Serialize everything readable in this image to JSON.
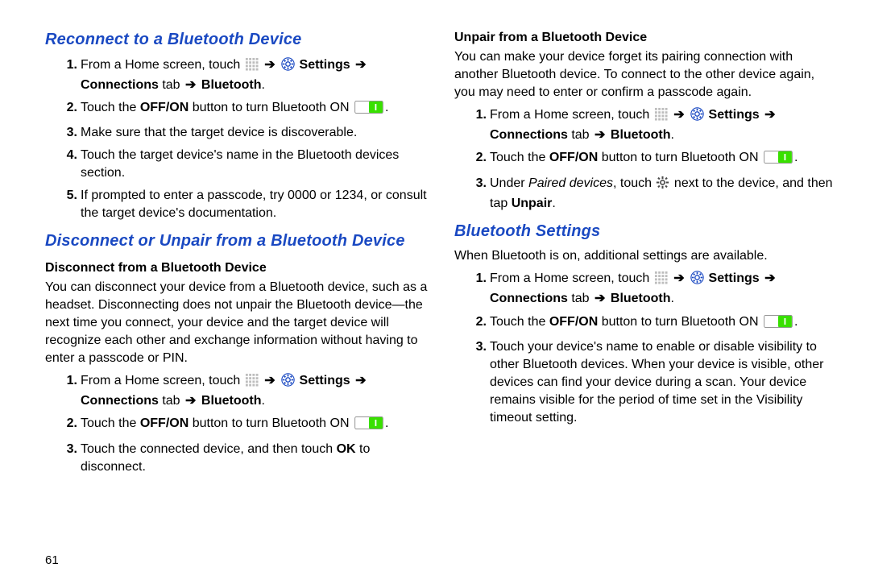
{
  "page_number": "61",
  "arrow": "➔",
  "icons": {
    "apps": "apps-grid-icon",
    "settings": "settings-gear-icon",
    "toggle": "toggle-on-icon",
    "gear": "device-gear-icon"
  },
  "left": {
    "sec1": {
      "title": "Reconnect to a Bluetooth Device",
      "steps": {
        "s1a": "From a Home screen, touch ",
        "s1b": " Settings ",
        "s1c": "Connections",
        "s1d": " tab ",
        "s1e": " Bluetooth",
        "s2a": "Touch the ",
        "s2b": "OFF/ON",
        "s2c": " button to turn Bluetooth ON ",
        "s3": "Make sure that the target device is discoverable.",
        "s4": "Touch the target device's name in the Bluetooth devices section.",
        "s5": "If prompted to enter a passcode, try 0000 or 1234, or consult the target device's documentation."
      }
    },
    "sec2": {
      "title": "Disconnect or Unpair from a Bluetooth Device",
      "sub1": {
        "title": "Disconnect from a Bluetooth Device",
        "intro": "You can disconnect your device from a Bluetooth device, such as a headset. Disconnecting does not unpair the Bluetooth device—the next time you connect, your device and the target device will recognize each other and exchange information without having to enter a passcode or PIN.",
        "steps": {
          "s1a": "From a Home screen, touch ",
          "s1b": " Settings ",
          "s1c": "Connections",
          "s1d": " tab ",
          "s1e": " Bluetooth",
          "s2a": "Touch the ",
          "s2b": "OFF/ON",
          "s2c": " button to turn Bluetooth ON ",
          "s3a": "Touch the connected device, and then touch ",
          "s3b": "OK",
          "s3c": " to disconnect."
        }
      }
    }
  },
  "right": {
    "sub2": {
      "title": "Unpair from a Bluetooth Device",
      "intro": "You can make your device forget its pairing connection with another Bluetooth device. To connect to the other device again, you may need to enter or confirm a passcode again.",
      "steps": {
        "s1a": "From a Home screen, touch ",
        "s1b": " Settings ",
        "s1c": "Connections",
        "s1d": " tab ",
        "s1e": " Bluetooth",
        "s2a": "Touch the ",
        "s2b": "OFF/ON",
        "s2c": " button to turn Bluetooth ON ",
        "s3a": "Under ",
        "s3b": "Paired devices",
        "s3c": ", touch ",
        "s3d": " next to the device, and then tap ",
        "s3e": "Unpair"
      }
    },
    "sec3": {
      "title": "Bluetooth Settings",
      "intro": "When Bluetooth is on, additional settings are available.",
      "steps": {
        "s1a": "From a Home screen, touch ",
        "s1b": " Settings ",
        "s1c": "Connections",
        "s1d": " tab ",
        "s1e": " Bluetooth",
        "s2a": "Touch the ",
        "s2b": "OFF/ON",
        "s2c": " button to turn Bluetooth ON ",
        "s3": "Touch your device's name to enable or disable visibility to other Bluetooth devices. When your device is visible, other devices can find your device during a scan. Your device remains visible for the period of time set in the Visibility timeout setting."
      }
    }
  }
}
